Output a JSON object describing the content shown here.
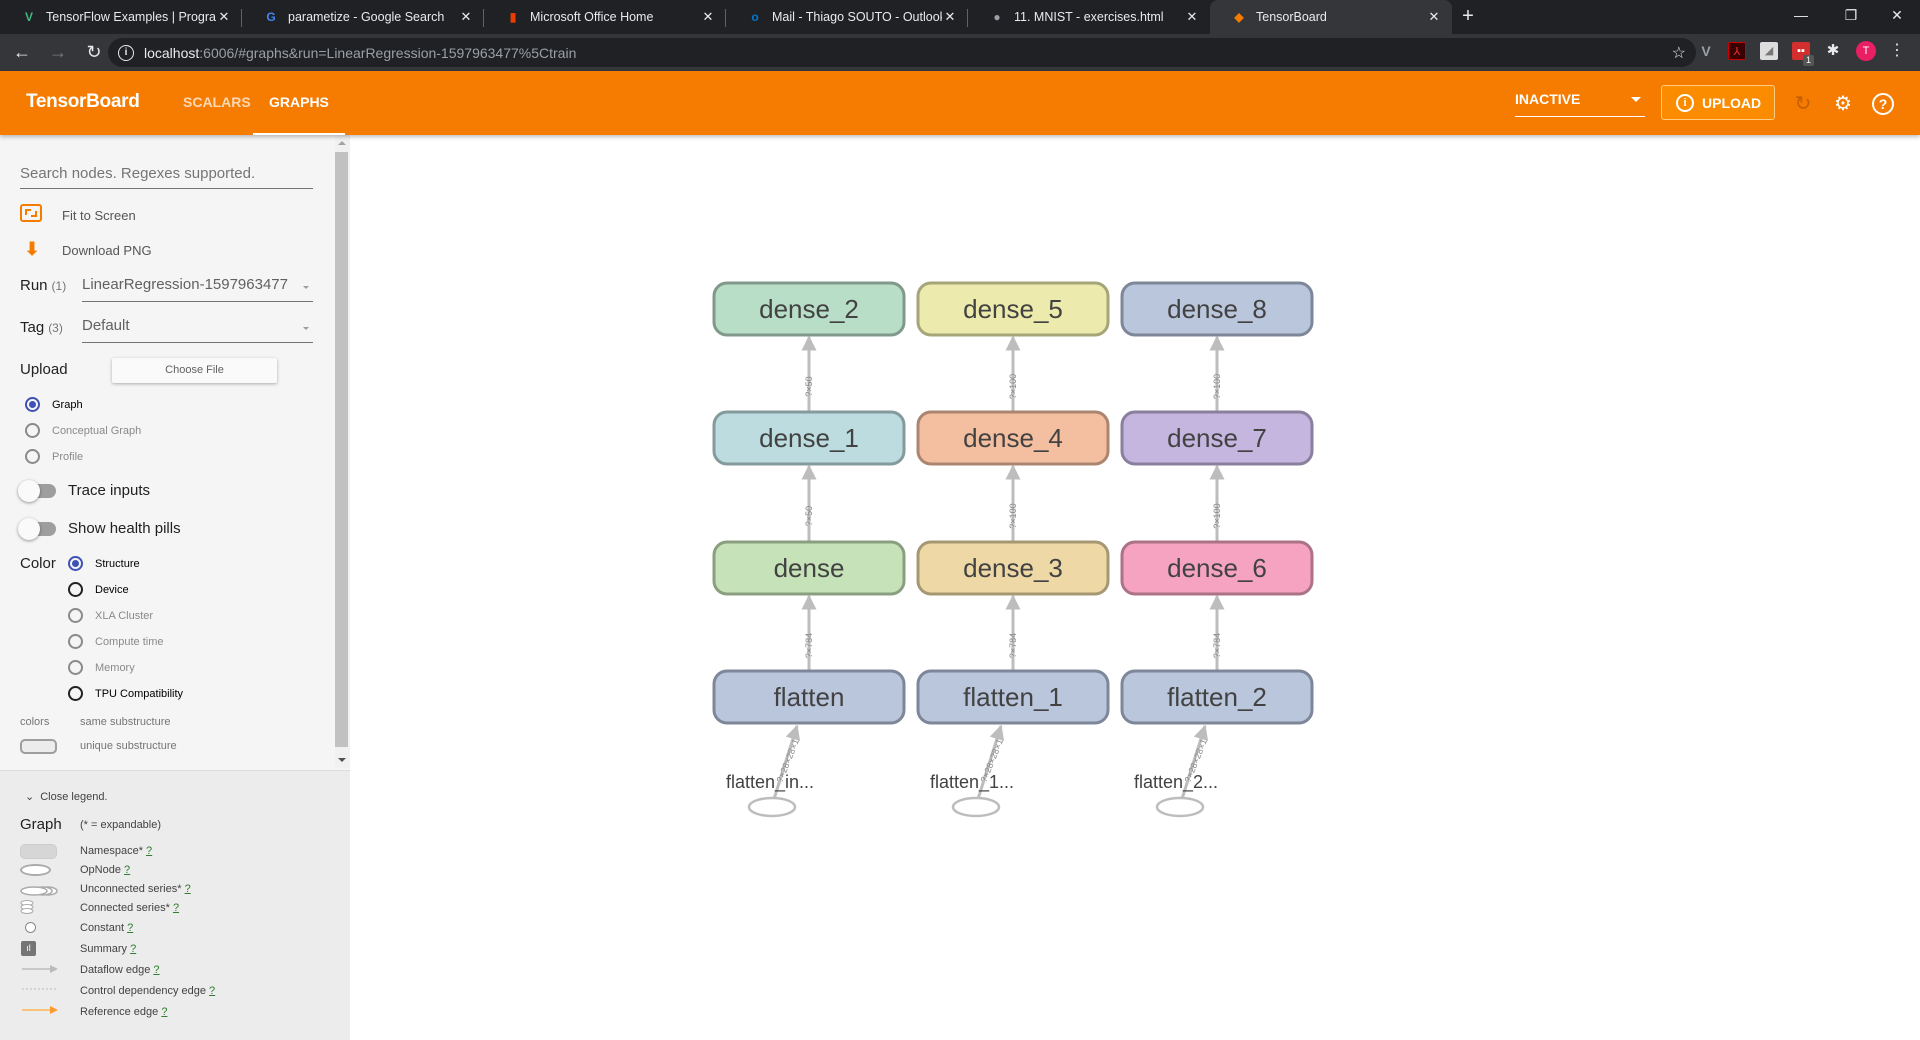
{
  "browser": {
    "tabs": [
      {
        "title": "TensorFlow Examples | Programm",
        "icon": "vue-icon",
        "icon_color": "#41b883",
        "active": false
      },
      {
        "title": "parametize - Google Search",
        "icon": "google-icon",
        "icon_color": "#4285f4",
        "active": false
      },
      {
        "title": "Microsoft Office Home",
        "icon": "office-icon",
        "icon_color": "#eb3c00",
        "active": false
      },
      {
        "title": "Mail - Thiago SOUTO - Outlook",
        "icon": "outlook-icon",
        "icon_color": "#0078d4",
        "active": false
      },
      {
        "title": "11. MNIST - exercises.html",
        "icon": "globe-icon",
        "icon_color": "#9aa0a6",
        "active": false
      },
      {
        "title": "TensorBoard",
        "icon": "tensorboard-icon",
        "icon_color": "#f57c00",
        "active": true
      }
    ],
    "close_glyph": "✕",
    "new_tab_glyph": "+",
    "url_host": "localhost",
    "url_rest": ":6006/#graphs&run=LinearRegression-1597963477%5Ctrain",
    "profile_initial": "T",
    "extension_badge": "1"
  },
  "header": {
    "brand": "TensorBoard",
    "tabs": [
      {
        "label": "SCALARS",
        "active": false
      },
      {
        "label": "GRAPHS",
        "active": true
      }
    ],
    "status_select": "INACTIVE",
    "upload_label": "UPLOAD",
    "accent_color": "#f57c00"
  },
  "sidebar": {
    "search_placeholder": "Search nodes. Regexes supported.",
    "fit_label": "Fit to Screen",
    "download_label": "Download PNG",
    "run_label": "Run",
    "run_count": "(1)",
    "run_value": "LinearRegression-1597963477",
    "tag_label": "Tag",
    "tag_count": "(3)",
    "tag_value": "Default",
    "upload_label": "Upload",
    "choose_file_label": "Choose File",
    "graph_types": [
      {
        "label": "Graph",
        "selected": true
      },
      {
        "label": "Conceptual Graph",
        "selected": false
      },
      {
        "label": "Profile",
        "selected": false
      }
    ],
    "trace_inputs_label": "Trace inputs",
    "health_pills_label": "Show health pills",
    "color_label": "Color",
    "color_options": [
      {
        "label": "Structure",
        "selected": true
      },
      {
        "label": "Device",
        "selected": false
      },
      {
        "label": "XLA Cluster",
        "selected": false
      },
      {
        "label": "Compute time",
        "selected": false
      },
      {
        "label": "Memory",
        "selected": false
      },
      {
        "label": "TPU Compatibility",
        "selected": false
      }
    ],
    "colors_label": "colors",
    "same_substructure": "same substructure",
    "unique_substructure": "unique substructure"
  },
  "legend": {
    "close_label": "Close legend.",
    "title": "Graph",
    "subtitle": "(* = expandable)",
    "items": [
      {
        "label": "Namespace*",
        "help": "?"
      },
      {
        "label": "OpNode",
        "help": "?"
      },
      {
        "label": "Unconnected series*",
        "help": "?"
      },
      {
        "label": "Connected series*",
        "help": "?"
      },
      {
        "label": "Constant",
        "help": "?"
      },
      {
        "label": "Summary",
        "help": "?"
      },
      {
        "label": "Dataflow edge",
        "help": "?"
      },
      {
        "label": "Control dependency edge",
        "help": "?"
      },
      {
        "label": "Reference edge",
        "help": "?"
      }
    ]
  },
  "graph": {
    "columns": [
      {
        "input_label": "flatten_in...",
        "input_edge_label": "?×28×28×1",
        "nodes": [
          {
            "name": "flatten",
            "fill": "#bac6dc",
            "stroke": "#7e8799"
          },
          {
            "name": "dense",
            "fill": "#c6e2b8",
            "stroke": "#8a9f80"
          },
          {
            "name": "dense_1",
            "fill": "#bcdcdf",
            "stroke": "#849a9c"
          },
          {
            "name": "dense_2",
            "fill": "#b8dec7",
            "stroke": "#80998a"
          }
        ],
        "edge_labels": [
          "?×784",
          "?×50",
          "?×50"
        ]
      },
      {
        "input_label": "flatten_1...",
        "input_edge_label": "?×28×28×1",
        "nodes": [
          {
            "name": "flatten_1",
            "fill": "#bac6dc",
            "stroke": "#7e8799"
          },
          {
            "name": "dense_3",
            "fill": "#eed8a6",
            "stroke": "#a79874"
          },
          {
            "name": "dense_4",
            "fill": "#f4bea0",
            "stroke": "#ab8570"
          },
          {
            "name": "dense_5",
            "fill": "#ecebad",
            "stroke": "#a6a579"
          }
        ],
        "edge_labels": [
          "?×784",
          "?×100",
          "?×100"
        ]
      },
      {
        "input_label": "flatten_2...",
        "input_edge_label": "?×28×28×1",
        "nodes": [
          {
            "name": "flatten_2",
            "fill": "#bac6dc",
            "stroke": "#7e8799"
          },
          {
            "name": "dense_6",
            "fill": "#f5a3c0",
            "stroke": "#ac7287"
          },
          {
            "name": "dense_7",
            "fill": "#c5b6e0",
            "stroke": "#8a7f9d"
          },
          {
            "name": "dense_8",
            "fill": "#bac6dc",
            "stroke": "#7e8799"
          }
        ],
        "edge_labels": [
          "?×784",
          "?×100",
          "?×100"
        ]
      }
    ]
  }
}
